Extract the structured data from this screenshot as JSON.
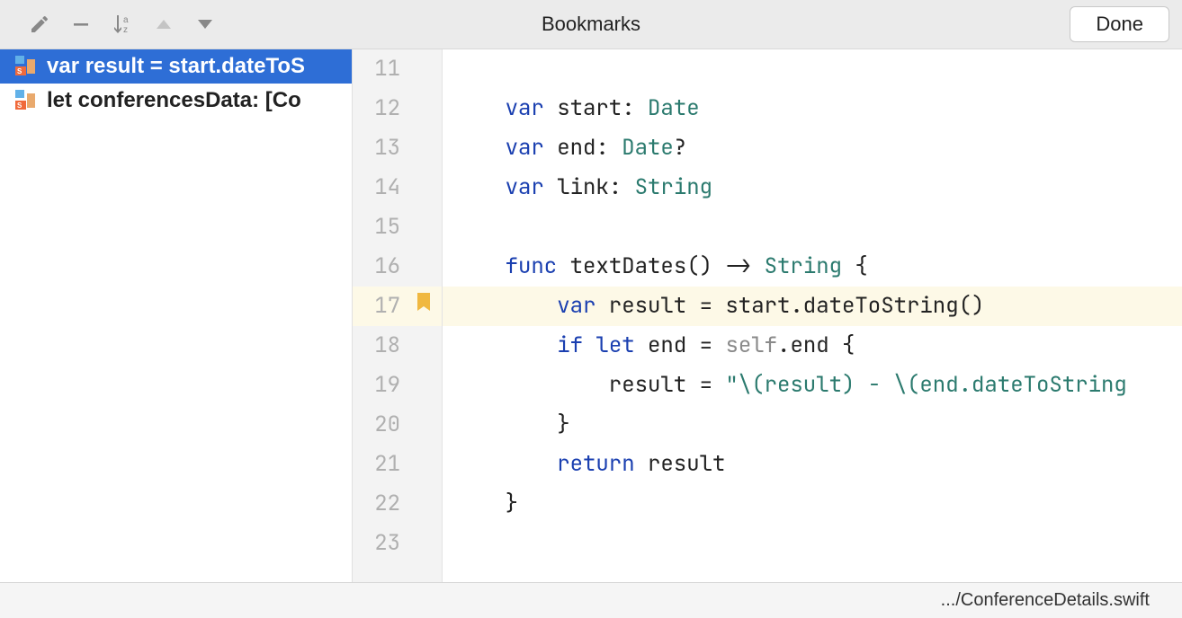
{
  "toolbar": {
    "title": "Bookmarks",
    "done_label": "Done"
  },
  "bookmarks": [
    {
      "label": "var result = start.dateToS",
      "selected": true
    },
    {
      "label": "let conferencesData: [Co",
      "selected": false
    }
  ],
  "editor": {
    "highlighted_line": 17,
    "lines": [
      {
        "n": 11,
        "tokens": []
      },
      {
        "n": 12,
        "tokens": [
          {
            "t": "    ",
            "c": "text"
          },
          {
            "t": "var",
            "c": "kw"
          },
          {
            "t": " start: ",
            "c": "text"
          },
          {
            "t": "Date",
            "c": "type"
          }
        ]
      },
      {
        "n": 13,
        "tokens": [
          {
            "t": "    ",
            "c": "text"
          },
          {
            "t": "var",
            "c": "kw"
          },
          {
            "t": " end: ",
            "c": "text"
          },
          {
            "t": "Date",
            "c": "type"
          },
          {
            "t": "?",
            "c": "text"
          }
        ]
      },
      {
        "n": 14,
        "tokens": [
          {
            "t": "    ",
            "c": "text"
          },
          {
            "t": "var",
            "c": "kw"
          },
          {
            "t": " link: ",
            "c": "text"
          },
          {
            "t": "String",
            "c": "type"
          }
        ]
      },
      {
        "n": 15,
        "tokens": []
      },
      {
        "n": 16,
        "tokens": [
          {
            "t": "    ",
            "c": "text"
          },
          {
            "t": "func",
            "c": "kw"
          },
          {
            "t": " textDates() -> ",
            "c": "text"
          },
          {
            "t": "String",
            "c": "type"
          },
          {
            "t": " {",
            "c": "text"
          }
        ]
      },
      {
        "n": 17,
        "tokens": [
          {
            "t": "        ",
            "c": "text"
          },
          {
            "t": "var",
            "c": "kw"
          },
          {
            "t": " result = start.dateToString()",
            "c": "text"
          }
        ]
      },
      {
        "n": 18,
        "tokens": [
          {
            "t": "        ",
            "c": "text"
          },
          {
            "t": "if",
            "c": "kw"
          },
          {
            "t": " ",
            "c": "text"
          },
          {
            "t": "let",
            "c": "kw"
          },
          {
            "t": " end = ",
            "c": "text"
          },
          {
            "t": "self",
            "c": "self"
          },
          {
            "t": ".end {",
            "c": "text"
          }
        ]
      },
      {
        "n": 19,
        "tokens": [
          {
            "t": "            result = ",
            "c": "text"
          },
          {
            "t": "\"\\(result) - \\(end.dateToString",
            "c": "str"
          }
        ]
      },
      {
        "n": 20,
        "tokens": [
          {
            "t": "        }",
            "c": "text"
          }
        ]
      },
      {
        "n": 21,
        "tokens": [
          {
            "t": "        ",
            "c": "text"
          },
          {
            "t": "return",
            "c": "kw"
          },
          {
            "t": " result",
            "c": "text"
          }
        ]
      },
      {
        "n": 22,
        "tokens": [
          {
            "t": "    }",
            "c": "text"
          }
        ]
      },
      {
        "n": 23,
        "tokens": []
      }
    ]
  },
  "statusbar": {
    "path": ".../ConferenceDetails.swift"
  }
}
